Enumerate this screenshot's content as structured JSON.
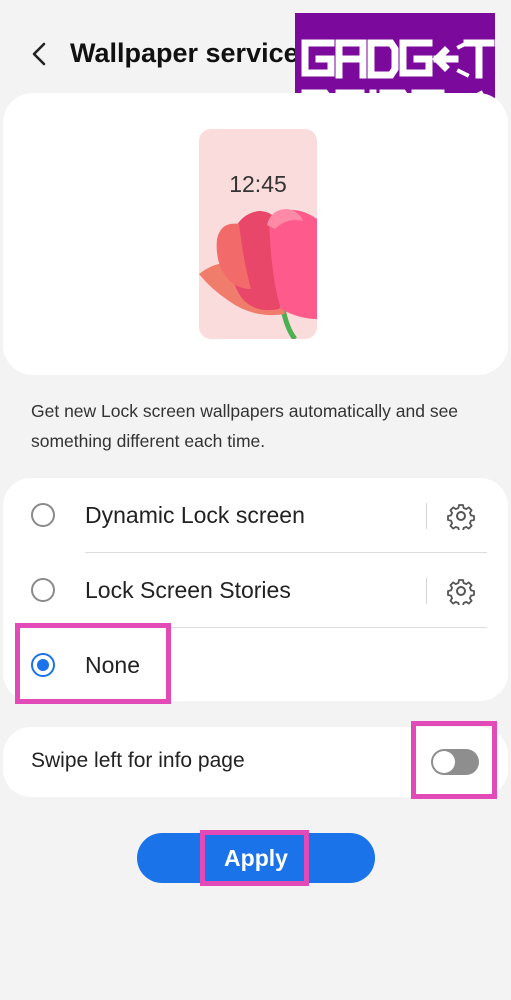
{
  "header": {
    "title": "Wallpaper service",
    "back_icon": "chevron-left-icon"
  },
  "watermark": {
    "line1": "GADGET",
    "line2": "BRIDGE",
    "background": "#7b0a9c"
  },
  "preview": {
    "clock": "12:45",
    "background": "#fbdcdc"
  },
  "description": "Get new Lock screen wallpapers automatically and see something different each time.",
  "options": [
    {
      "label": "Dynamic Lock screen",
      "selected": false,
      "settings_icon": "gear-icon"
    },
    {
      "label": "Lock Screen Stories",
      "selected": false,
      "settings_icon": "gear-icon"
    },
    {
      "label": "None",
      "selected": true
    }
  ],
  "swipe_option": {
    "label": "Swipe left for info page",
    "enabled": false
  },
  "apply_button": {
    "label": "Apply",
    "color": "#1a73e8"
  },
  "colors": {
    "accent": "#1a73e8",
    "highlight": "#e24ab8"
  }
}
